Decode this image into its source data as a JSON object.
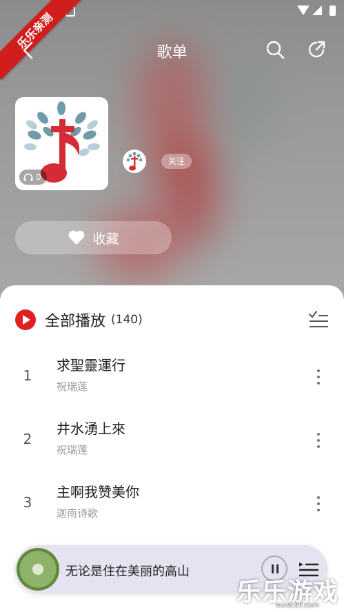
{
  "ribbon": {
    "text": "乐乐亲测"
  },
  "header": {
    "title": "歌单"
  },
  "playlist": {
    "play_count": "0",
    "follow_label": "关注",
    "collect_label": "收藏"
  },
  "list": {
    "play_all_label": "全部播放",
    "count_label": "(140)",
    "songs": [
      {
        "index": "1",
        "title": "求聖靈運行",
        "artist": "祝瑞莲"
      },
      {
        "index": "2",
        "title": "井水湧上來",
        "artist": "祝瑞莲"
      },
      {
        "index": "3",
        "title": "主啊我赞美你",
        "artist": "迦南诗歌"
      }
    ]
  },
  "player": {
    "now_playing": "无论是住在美丽的高山"
  },
  "watermark": {
    "text": "乐乐游戏",
    "sub": "www.6ll.com"
  },
  "colors": {
    "accent": "#e02020",
    "sheet": "#ffffff",
    "player_bg": "#e6e2f1"
  }
}
